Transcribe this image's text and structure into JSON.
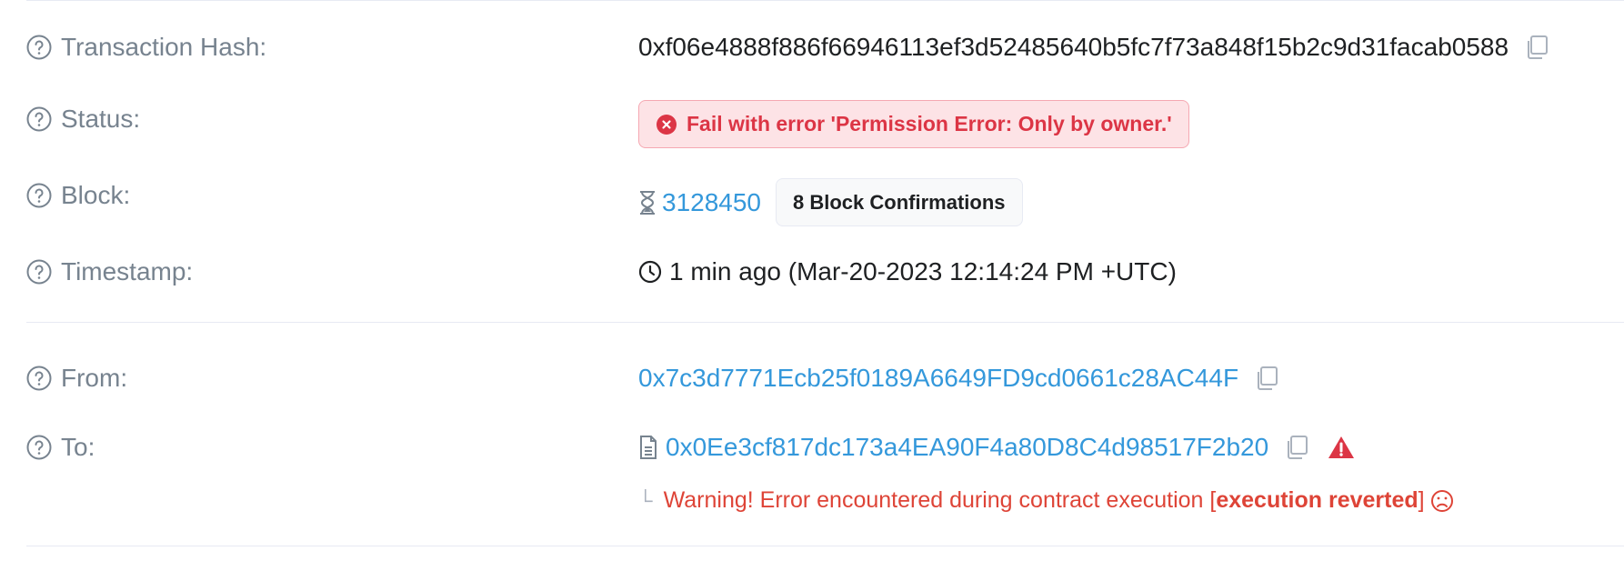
{
  "rows": {
    "tx_hash": {
      "label": "Transaction Hash:",
      "value": "0xf06e4888f886f66946113ef3d52485640b5fc7f73a848f15b2c9d31facab0588"
    },
    "status": {
      "label": "Status:",
      "value": "Fail with error 'Permission Error: Only by owner.'"
    },
    "block": {
      "label": "Block:",
      "number": "3128450",
      "confirmations": "8 Block Confirmations"
    },
    "timestamp": {
      "label": "Timestamp:",
      "value": "1 min ago (Mar-20-2023 12:14:24 PM +UTC)"
    },
    "from": {
      "label": "From:",
      "address": "0x7c3d7771Ecb25f0189A6649FD9cd0661c28AC44F"
    },
    "to": {
      "label": "To:",
      "address": "0x0Ee3cf817dc173a4EA90F4a80D8C4d98517F2b20",
      "warning_prefix": "Warning! Error encountered during contract execution [",
      "warning_bold": "execution reverted",
      "warning_suffix": "]"
    }
  },
  "icons": {
    "help": "question-circle-icon",
    "copy": "copy-icon",
    "error": "x-circle-icon",
    "hourglass": "hourglass-icon",
    "clock": "clock-icon",
    "contract": "document-icon",
    "alert": "warning-triangle-icon",
    "frown": "frown-icon"
  },
  "colors": {
    "label": "#77838f",
    "link": "#3498db",
    "error": "#dc3545",
    "warning_text": "#de4437",
    "status_bg": "#fde3e6"
  }
}
